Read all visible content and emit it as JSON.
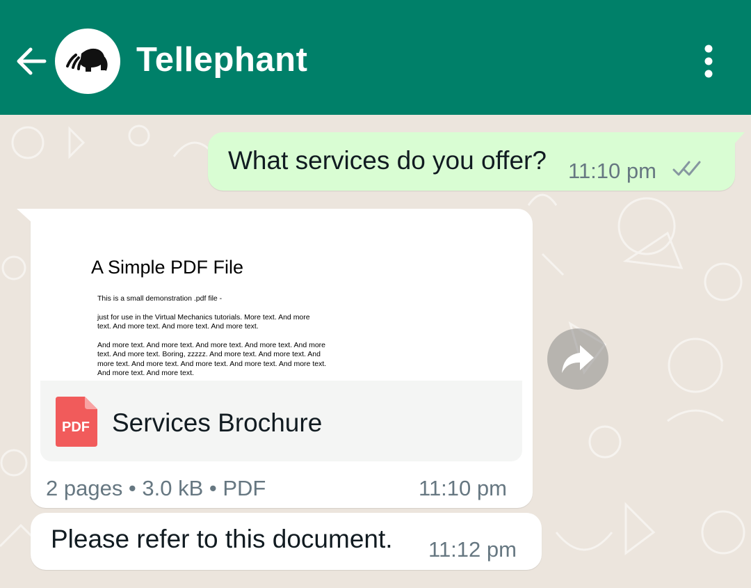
{
  "header": {
    "contact_name": "Tellephant",
    "background_color": "#008069",
    "back_icon": "arrow-left-icon",
    "menu_icon": "more-vertical-icon"
  },
  "messages": {
    "outgoing": {
      "text": "What services do you offer?",
      "time": "11:10 pm",
      "status_icon": "double-check-icon",
      "bubble_color": "#d9fdd3"
    },
    "document": {
      "preview": {
        "title": "A Simple PDF File",
        "lines": [
          "This is a small demonstration .pdf file -",
          "just for use in the Virtual Mechanics tutorials. More text. And more",
          "text. And more text. And more text. And more text.",
          "And more text. And more text. And more text. And more text. And more",
          "text. And more text. Boring, zzzzz. And more text. And more text. And",
          "more text. And more text. And more text. And more text. And more text.",
          "And more text. And more text."
        ]
      },
      "file_icon_label": "PDF",
      "file_name": "Services Brochure",
      "meta": "2 pages • 3.0 kB • PDF",
      "time": "11:10 pm"
    },
    "incoming": {
      "text": "Please refer to this document.",
      "time": "11:12 pm"
    }
  },
  "forward_icon": "forward-arrow-icon"
}
